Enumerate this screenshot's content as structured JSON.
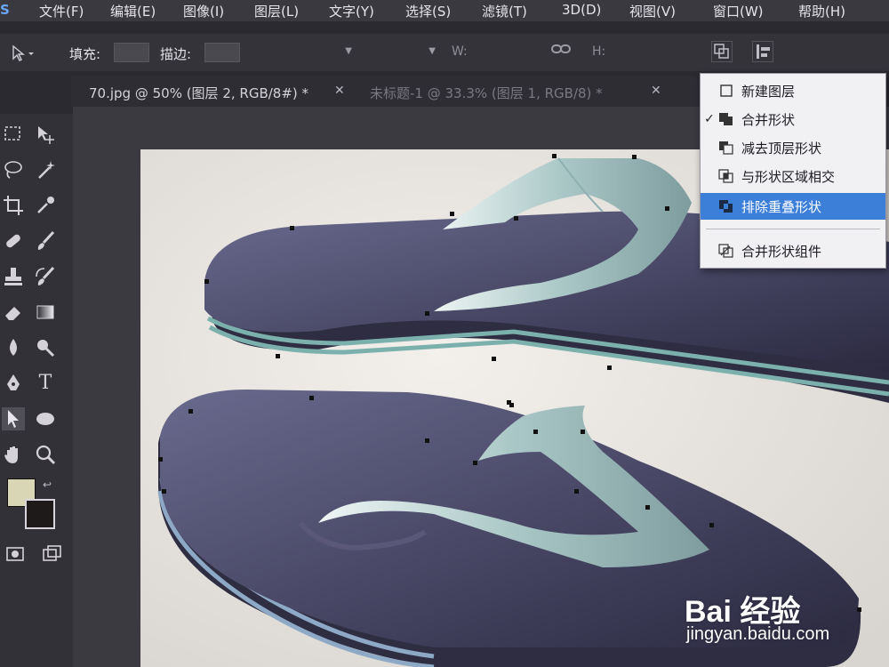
{
  "menubar": {
    "app_logo": "S",
    "items": [
      "文件(F)",
      "编辑(E)",
      "图像(I)",
      "图层(L)",
      "文字(Y)",
      "选择(S)",
      "滤镜(T)",
      "3D(D)",
      "视图(V)",
      "窗口(W)",
      "帮助(H)"
    ]
  },
  "options": {
    "fill_label": "填充:",
    "stroke_label": "描边:",
    "w_label": "W:",
    "h_label": "H:",
    "link_icon": "link-icon",
    "path_ops_icons": [
      "path-operations-icon",
      "path-alignment-icon",
      "path-arrangement-icon"
    ]
  },
  "tabs": [
    {
      "label": "70.jpg @ 50% (图层 2, RGB/8#) *",
      "active": true
    },
    {
      "label": "未标题-1 @ 33.3% (图层 1, RGB/8) *",
      "active": false
    }
  ],
  "toolbox": {
    "tool_icons": [
      "move-tool-icon",
      "marquee-tool-icon",
      "lasso-tool-icon",
      "magic-wand-icon",
      "crop-tool-icon",
      "eyedropper-icon",
      "healing-brush-icon",
      "brush-tool-icon",
      "clone-stamp-icon",
      "history-brush-icon",
      "eraser-tool-icon",
      "gradient-tool-icon",
      "blur-tool-icon",
      "dodge-tool-icon",
      "pen-tool-icon",
      "type-tool-icon",
      "path-selection-icon",
      "ellipse-tool-icon",
      "hand-tool-icon",
      "zoom-tool-icon"
    ],
    "foreground_color": "#d9d6b6",
    "background_color": "#1e1a1a"
  },
  "shape_menu": {
    "items": [
      {
        "label": "新建图层",
        "checked": false,
        "selected": false,
        "icon": "new-layer-icon"
      },
      {
        "label": "合并形状",
        "checked": true,
        "selected": false,
        "icon": "combine-shapes-icon"
      },
      {
        "label": "减去顶层形状",
        "checked": false,
        "selected": false,
        "icon": "subtract-front-shape-icon"
      },
      {
        "label": "与形状区域相交",
        "checked": false,
        "selected": false,
        "icon": "intersect-shape-areas-icon"
      },
      {
        "label": "排除重叠形状",
        "checked": false,
        "selected": true,
        "icon": "exclude-overlapping-shapes-icon"
      },
      {
        "label": "合并形状组件",
        "checked": false,
        "selected": false,
        "icon": "merge-shape-components-icon"
      }
    ],
    "check_mark": "✓"
  },
  "watermark": {
    "logo_text": "Bai 经验",
    "url": "jingyan.baidu.com"
  },
  "colors": {
    "menu_highlight": "#3c7fd8",
    "sole": "#4b4a6a",
    "strap": "#bcd6d4"
  }
}
